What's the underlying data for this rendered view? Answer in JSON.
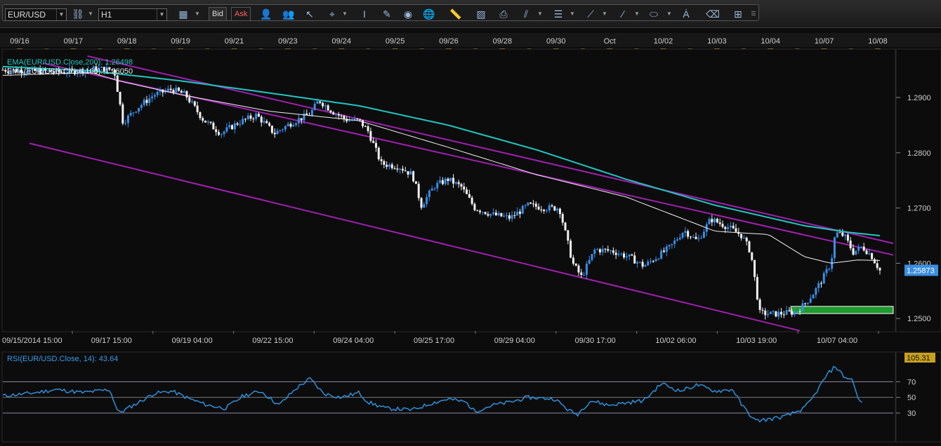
{
  "toolbar": {
    "symbol": "EUR/USD",
    "timeframe": "H1",
    "bid_label": "Bid",
    "ask_label": "Ask"
  },
  "colors": {
    "background": "#0c0c0c",
    "ema200": "#22c5c0",
    "ema100": "#f0f0f0",
    "channel": "#a020b0",
    "candle_up": "#3a8ee8",
    "candle_down": "#f2f2f2",
    "rsi_line": "#2f8fd8",
    "support_zone": "#1f9a2e",
    "price_tag": "#3c8fe0"
  },
  "chart_data": [
    {
      "type": "candlestick",
      "instrument": "EUR/USD",
      "timeframe": "H1",
      "indicators": [
        {
          "name": "EMA(EUR/USD.Close,200)",
          "value": "1.26498"
        },
        {
          "name": "EMA(EUR/USD.Close,100)",
          "value": "1.26050"
        }
      ],
      "top_dates": [
        "09/16",
        "09/17",
        "09/18",
        "09/19",
        "09/21",
        "09/23",
        "09/24",
        "09/25",
        "09/26",
        "09/28",
        "09/30",
        "Oct",
        "10/02",
        "10/03",
        "10/04",
        "10/07",
        "10/08"
      ],
      "bottom_dates": [
        "09/15/2014 15:00",
        "09/17 15:00",
        "09/19 04:00",
        "09/22 15:00",
        "09/24 04:00",
        "09/25 17:00",
        "09/29 04:00",
        "09/30 17:00",
        "10/02 06:00",
        "10/03 19:00",
        "10/07 04:00"
      ],
      "y_ticks": [
        "1.2900",
        "1.2800",
        "1.2700",
        "1.2600",
        "1.2500"
      ],
      "ylim": [
        1.248,
        1.2985
      ],
      "last_price": "1.25873",
      "price_path": [
        [
          0,
          1.295
        ],
        [
          0.035,
          1.2948
        ],
        [
          0.07,
          1.2946
        ],
        [
          0.105,
          1.2952
        ],
        [
          0.125,
          1.295
        ],
        [
          0.135,
          1.2855
        ],
        [
          0.15,
          1.288
        ],
        [
          0.17,
          1.2905
        ],
        [
          0.19,
          1.2915
        ],
        [
          0.205,
          1.2905
        ],
        [
          0.225,
          1.286
        ],
        [
          0.245,
          1.2835
        ],
        [
          0.265,
          1.2855
        ],
        [
          0.285,
          1.2868
        ],
        [
          0.305,
          1.2835
        ],
        [
          0.325,
          1.2855
        ],
        [
          0.345,
          1.287
        ],
        [
          0.355,
          1.2895
        ],
        [
          0.37,
          1.2875
        ],
        [
          0.385,
          1.286
        ],
        [
          0.4,
          1.2858
        ],
        [
          0.41,
          1.284
        ],
        [
          0.425,
          1.278
        ],
        [
          0.445,
          1.2775
        ],
        [
          0.46,
          1.276
        ],
        [
          0.47,
          1.2705
        ],
        [
          0.485,
          1.274
        ],
        [
          0.5,
          1.2752
        ],
        [
          0.515,
          1.2738
        ],
        [
          0.53,
          1.27
        ],
        [
          0.55,
          1.2688
        ],
        [
          0.57,
          1.2682
        ],
        [
          0.59,
          1.2705
        ],
        [
          0.61,
          1.27
        ],
        [
          0.625,
          1.27
        ],
        [
          0.64,
          1.26
        ],
        [
          0.65,
          1.2575
        ],
        [
          0.665,
          1.2625
        ],
        [
          0.685,
          1.2622
        ],
        [
          0.705,
          1.261
        ],
        [
          0.72,
          1.2595
        ],
        [
          0.735,
          1.2612
        ],
        [
          0.75,
          1.263
        ],
        [
          0.765,
          1.266
        ],
        [
          0.78,
          1.264
        ],
        [
          0.795,
          1.268
        ],
        [
          0.815,
          1.2665
        ],
        [
          0.83,
          1.265
        ],
        [
          0.84,
          1.262
        ],
        [
          0.85,
          1.251
        ],
        [
          0.865,
          1.2508
        ],
        [
          0.88,
          1.251
        ],
        [
          0.89,
          1.2512
        ],
        [
          0.9,
          1.2525
        ],
        [
          0.91,
          1.2545
        ],
        [
          0.92,
          1.257
        ],
        [
          0.93,
          1.26
        ],
        [
          0.935,
          1.2655
        ],
        [
          0.945,
          1.265
        ],
        [
          0.955,
          1.262
        ],
        [
          0.965,
          1.263
        ],
        [
          0.975,
          1.2615
        ],
        [
          0.985,
          1.2587
        ]
      ],
      "ema200_path": [
        [
          0,
          1.2956
        ],
        [
          0.1,
          1.2948
        ],
        [
          0.2,
          1.293
        ],
        [
          0.3,
          1.2908
        ],
        [
          0.4,
          1.2885
        ],
        [
          0.5,
          1.285
        ],
        [
          0.6,
          1.2805
        ],
        [
          0.7,
          1.2752
        ],
        [
          0.8,
          1.2705
        ],
        [
          0.9,
          1.2668
        ],
        [
          0.95,
          1.2656
        ],
        [
          0.985,
          1.265
        ]
      ],
      "ema100_path": [
        [
          0,
          1.294
        ],
        [
          0.1,
          1.2945
        ],
        [
          0.13,
          1.293
        ],
        [
          0.2,
          1.2905
        ],
        [
          0.3,
          1.2875
        ],
        [
          0.4,
          1.2858
        ],
        [
          0.5,
          1.281
        ],
        [
          0.6,
          1.276
        ],
        [
          0.7,
          1.272
        ],
        [
          0.8,
          1.2658
        ],
        [
          0.86,
          1.2652
        ],
        [
          0.9,
          1.2612
        ],
        [
          0.93,
          1.26
        ],
        [
          0.96,
          1.2606
        ],
        [
          0.985,
          1.2605
        ]
      ],
      "channel_lines": [
        {
          "from": [
            0.095,
            1.2975
          ],
          "to": [
            1.0,
            1.2636
          ]
        },
        {
          "from": [
            0.045,
            1.2962
          ],
          "to": [
            1.0,
            1.2615
          ]
        },
        {
          "from": [
            0.03,
            1.2817
          ],
          "to": [
            0.895,
            1.2478
          ]
        }
      ],
      "support_zone": {
        "x_range": [
          0.885,
          1.0
        ],
        "y_range": [
          1.2509,
          1.2522
        ]
      }
    },
    {
      "type": "line",
      "title": "RSI(EUR/USD.Close, 14): 43.64",
      "ylim": [
        -5.0,
        105.31
      ],
      "y_ticks": [
        "105.31",
        "70",
        "50",
        "30"
      ],
      "levels": [
        70,
        50,
        30
      ],
      "values": [
        [
          0,
          52
        ],
        [
          0.03,
          55
        ],
        [
          0.06,
          60
        ],
        [
          0.09,
          56
        ],
        [
          0.12,
          60
        ],
        [
          0.13,
          30
        ],
        [
          0.15,
          42
        ],
        [
          0.17,
          55
        ],
        [
          0.19,
          58
        ],
        [
          0.21,
          48
        ],
        [
          0.23,
          40
        ],
        [
          0.25,
          36
        ],
        [
          0.27,
          52
        ],
        [
          0.29,
          58
        ],
        [
          0.31,
          40
        ],
        [
          0.33,
          62
        ],
        [
          0.345,
          74
        ],
        [
          0.36,
          55
        ],
        [
          0.38,
          50
        ],
        [
          0.4,
          56
        ],
        [
          0.41,
          44
        ],
        [
          0.43,
          36
        ],
        [
          0.46,
          34
        ],
        [
          0.48,
          42
        ],
        [
          0.5,
          48
        ],
        [
          0.52,
          44
        ],
        [
          0.53,
          32
        ],
        [
          0.55,
          40
        ],
        [
          0.57,
          44
        ],
        [
          0.59,
          50
        ],
        [
          0.62,
          48
        ],
        [
          0.635,
          34
        ],
        [
          0.645,
          28
        ],
        [
          0.66,
          46
        ],
        [
          0.68,
          40
        ],
        [
          0.7,
          43
        ],
        [
          0.72,
          46
        ],
        [
          0.74,
          68
        ],
        [
          0.76,
          58
        ],
        [
          0.78,
          66
        ],
        [
          0.8,
          58
        ],
        [
          0.82,
          60
        ],
        [
          0.83,
          40
        ],
        [
          0.845,
          20
        ],
        [
          0.86,
          22
        ],
        [
          0.88,
          26
        ],
        [
          0.9,
          36
        ],
        [
          0.91,
          50
        ],
        [
          0.925,
          78
        ],
        [
          0.935,
          90
        ],
        [
          0.945,
          76
        ],
        [
          0.955,
          72
        ],
        [
          0.96,
          48
        ],
        [
          0.965,
          43.64
        ]
      ]
    }
  ]
}
